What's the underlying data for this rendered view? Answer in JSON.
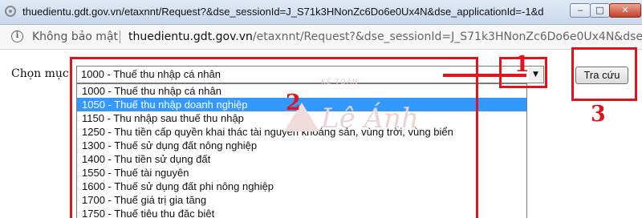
{
  "window": {
    "title": "thuedientu.gdt.gov.vn/etaxnnt/Request?&dse_sessionId=J_S71k3HNonZc6Do6e0Ux4N&dse_applicationId=-1&dse_...",
    "min_glyph": "‒",
    "max_glyph": "□",
    "close_glyph": "✕"
  },
  "addressbar": {
    "security_label": "Không bảo mật",
    "url_host": "thuedientu.gdt.gov.vn",
    "url_rest": "/etaxnnt/Request?&dse_sessionId=J_S71k3HNonZc6Do6e0Ux4N&dse_..."
  },
  "form": {
    "label": "Chọn mục",
    "selected_value": "1000 - Thuế thu nhập cá nhân",
    "arrow_glyph": "▼",
    "search_button": "Tra cứu"
  },
  "dropdown": {
    "options": [
      "1000 - Thuế thu nhập cá nhân",
      "1050 - Thuế thu nhập doanh nghiệp",
      "1150 - Thu nhập sau thuế thu nhập",
      "1250 - Thu tiền cấp quyền khai thác tài nguyên khoáng sản, vùng trời, vùng biển",
      "1300 - Thuế sử dụng đất nông nghiệp",
      "1400 - Thu tiền sử dụng đất",
      "1550 - Thuế tài nguyên",
      "1600 - Thuế sử dụng đất phi nông nghiệp",
      "1700 - Thuế giá trị gia tăng",
      "1750 - Thuế tiêu thụ đặc biệt"
    ],
    "highlighted_index": 1
  },
  "watermark": {
    "subtitle": "KẾ TOÁN",
    "name": "Lê Ánh"
  },
  "annotations": {
    "num_1": "1",
    "num_2": "2",
    "num_3": "3",
    "color": "#e0141e"
  }
}
